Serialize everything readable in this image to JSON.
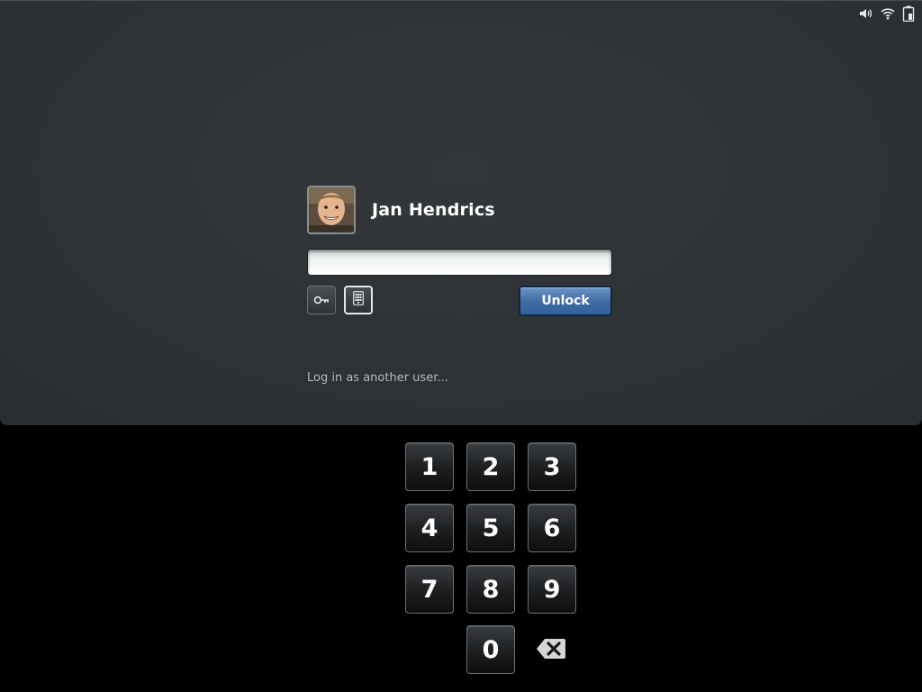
{
  "status_bar": {
    "icons": [
      "volume-icon",
      "wifi-icon",
      "battery-icon"
    ]
  },
  "user": {
    "name": "Jan Hendrics",
    "avatar": "user-avatar-photo"
  },
  "password": {
    "value": "",
    "placeholder": ""
  },
  "auth_methods": {
    "key_icon": "key-icon",
    "keypad_icon": "keypad-icon",
    "selected": "keypad"
  },
  "unlock_button": {
    "label": "Unlock"
  },
  "other_user_link": {
    "label": "Log in as another user..."
  },
  "keypad": {
    "keys": [
      "1",
      "2",
      "3",
      "4",
      "5",
      "6",
      "7",
      "8",
      "9",
      "0"
    ],
    "backspace_icon": "backspace-icon"
  },
  "colors": {
    "panel_bg": "#2f3336",
    "accent": "#3f6aa3",
    "keypad_bg": "#000000"
  }
}
